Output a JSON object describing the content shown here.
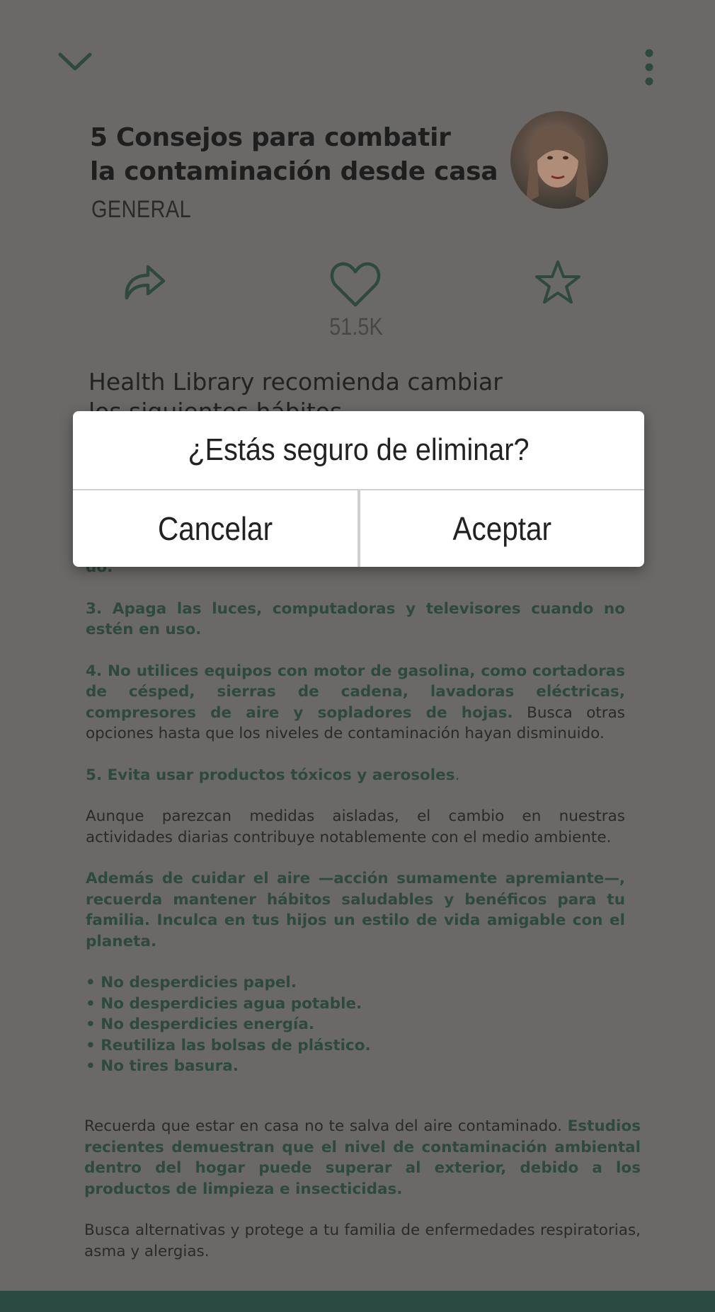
{
  "colors": {
    "accent": "#2c4a3e",
    "overlay": "#6b6967",
    "dialog_bg": "#ffffff"
  },
  "header": {
    "collapse_icon": "chevron-down-icon",
    "menu_icon": "more-vertical-icon"
  },
  "post": {
    "title_line1": "5 Consejos para combatir",
    "title_line2": "la contaminación desde casa",
    "category": "GENERAL",
    "likes": "51.5K",
    "intro_line1": "Health Library recomienda cambiar",
    "intro_line2": "los siguientes hábitos"
  },
  "actions": {
    "share_icon": "share-icon",
    "like_icon": "heart-icon",
    "favorite_icon": "star-icon"
  },
  "article": {
    "p2_cont": "do.",
    "p3": "3. Apaga las luces, computadoras y televisores cuando no estén en uso.",
    "p4_bold": "4. No utilices equipos con motor de gasolina, como cortadoras de césped, sierras de cadena, lavadoras eléctricas, compresores de aire y sopladores de hojas.",
    "p4_rest": " Busca otras opciones hasta que los niveles de contaminación hayan disminuido.",
    "p5": "5. Evita usar productos tóxicos y aerosoles",
    "p5_dot": ".",
    "p6": "Aunque parezcan medidas aisladas, el cambio en nuestras actividades diarias contribuye notablemente con el medio ambiente.",
    "p7": "Además de cuidar el aire —acción sumamente apremiante—, recuerda mantener hábitos saludables y benéficos para tu familia. Inculca en tus hijos un estilo de vida amigable con el planeta.",
    "bullets": [
      "• No desperdicies papel.",
      "• No desperdicies agua potable.",
      "• No desperdicies energía.",
      "• Reutiliza las bolsas de plástico.",
      "• No tires basura."
    ],
    "p8_plain": "Recuerda que estar en casa no te salva del aire contaminado. ",
    "p8_bold": "Estudios recientes demuestran que el nivel de contaminación ambiental dentro del hogar puede superar al exterior, debido a los productos de limpieza e insecticidas.",
    "p9": "Busca alternativas y protege a tu familia de enfermedades respiratorias, asma y alergias."
  },
  "dialog": {
    "message": "¿Estás seguro de eliminar?",
    "cancel_label": "Cancelar",
    "accept_label": "Aceptar"
  }
}
